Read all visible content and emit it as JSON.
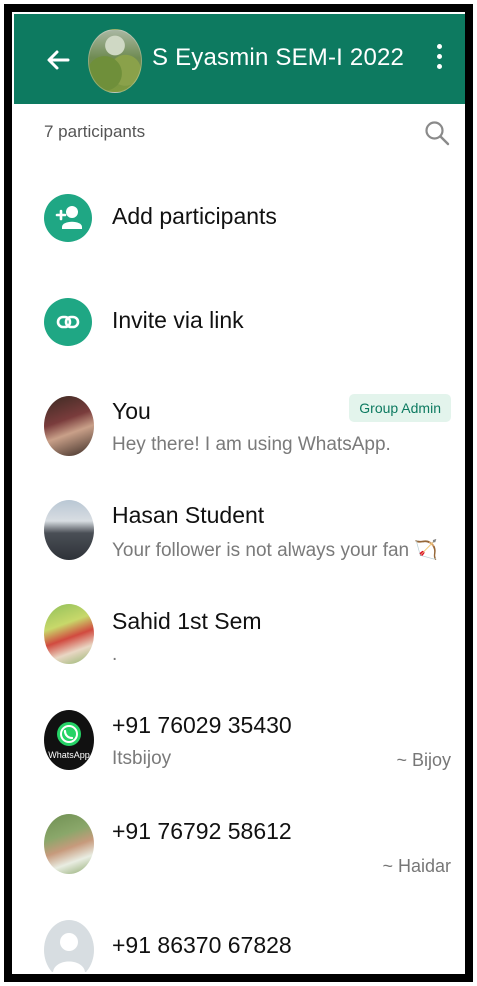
{
  "header": {
    "title": "S Eyasmin SEM-I 2022",
    "back_icon": "arrow-left-icon",
    "menu_icon": "more-vertical-icon",
    "bar_color": "#0d7a60"
  },
  "participants": {
    "count_label": "7 participants",
    "search_icon": "search-icon"
  },
  "actions": [
    {
      "label": "Add participants",
      "icon": "add-person-icon"
    },
    {
      "label": "Invite via link",
      "icon": "link-icon"
    }
  ],
  "members": [
    {
      "name": "You",
      "status": "Hey there! I am using WhatsApp.",
      "badge": "Group Admin",
      "alias": ""
    },
    {
      "name": "Hasan Student",
      "status": "Your follower is not always your fan 🏹",
      "badge": "",
      "alias": ""
    },
    {
      "name": "Sahid 1st Sem",
      "status": ".",
      "badge": "",
      "alias": ""
    },
    {
      "name": "+91 76029 35430",
      "status": "Itsbijoy",
      "badge": "",
      "alias": "~ Bijoy",
      "avatar_text": "WhatsApp"
    },
    {
      "name": "+91 76792 58612",
      "status": "",
      "badge": "",
      "alias": "~ Haidar"
    },
    {
      "name": "+91 86370 67828",
      "status": "",
      "badge": "",
      "alias": ""
    }
  ],
  "colors": {
    "accent": "#1fa784",
    "badge_bg": "#e3f4ec"
  }
}
